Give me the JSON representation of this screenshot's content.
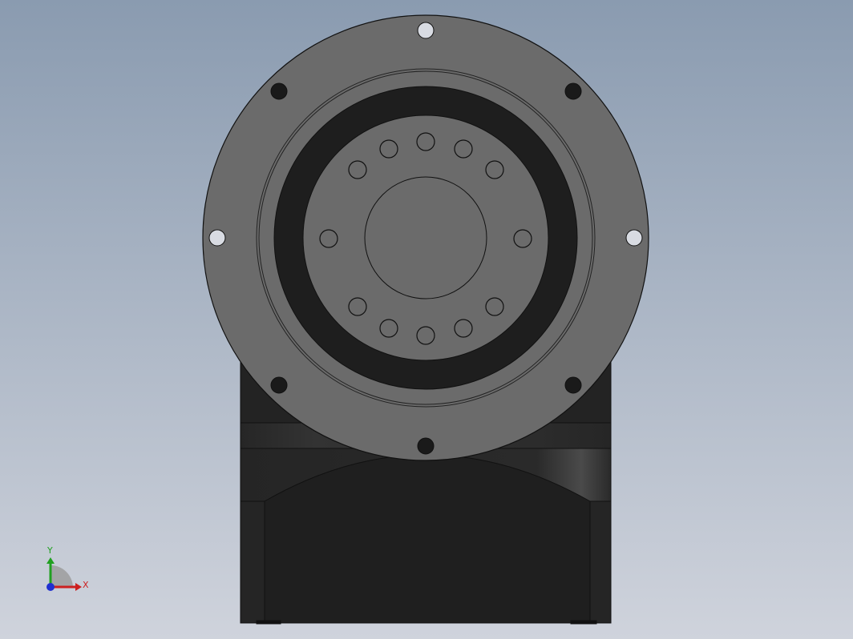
{
  "viewport": {
    "background_top": "#8a9bb0",
    "background_bottom": "#cfd3dc",
    "part_face_color": "#6b6b6b",
    "part_dark_color": "#1e1e1e",
    "housing_color": "#232323"
  },
  "triad": {
    "x_label": "X",
    "y_label": "Y",
    "x_color": "#cc2020",
    "y_color": "#20a020",
    "z_color": "#2030d0"
  }
}
